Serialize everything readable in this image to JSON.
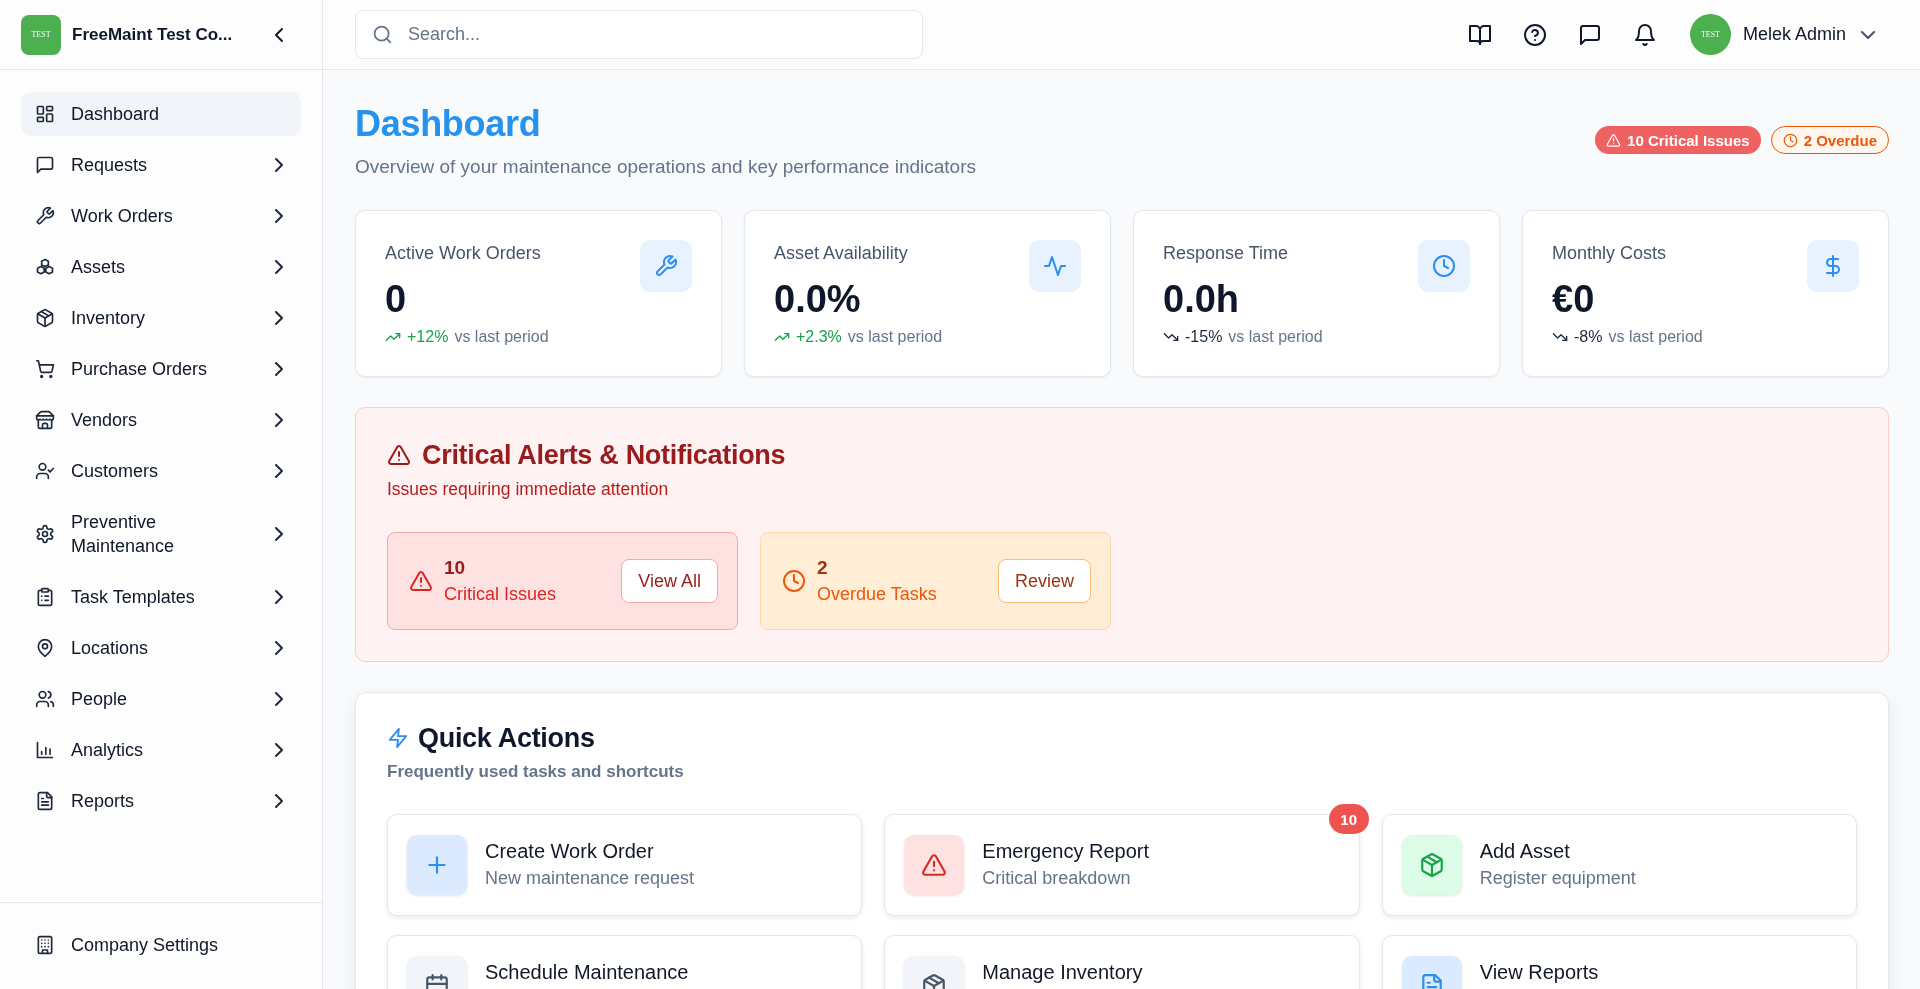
{
  "sidebar": {
    "logo_text": "TEST",
    "brand": "FreeMaint Test Co...",
    "items": [
      {
        "label": "Dashboard",
        "selected": true,
        "expandable": false
      },
      {
        "label": "Requests",
        "selected": false,
        "expandable": true
      },
      {
        "label": "Work Orders",
        "selected": false,
        "expandable": true
      },
      {
        "label": "Assets",
        "selected": false,
        "expandable": true
      },
      {
        "label": "Inventory",
        "selected": false,
        "expandable": true
      },
      {
        "label": "Purchase Orders",
        "selected": false,
        "expandable": true
      },
      {
        "label": "Vendors",
        "selected": false,
        "expandable": true
      },
      {
        "label": "Customers",
        "selected": false,
        "expandable": true
      },
      {
        "label": "Preventive Maintenance",
        "selected": false,
        "expandable": true
      },
      {
        "label": "Task Templates",
        "selected": false,
        "expandable": true
      },
      {
        "label": "Locations",
        "selected": false,
        "expandable": true
      },
      {
        "label": "People",
        "selected": false,
        "expandable": true
      },
      {
        "label": "Analytics",
        "selected": false,
        "expandable": true
      },
      {
        "label": "Reports",
        "selected": false,
        "expandable": true
      }
    ],
    "footer_item": {
      "label": "Company Settings"
    }
  },
  "header": {
    "search": {
      "placeholder": "Search..."
    },
    "user": {
      "avatar_text": "TEST",
      "name": "Melek Admin"
    }
  },
  "page": {
    "title": "Dashboard",
    "subtitle": "Overview of your maintenance operations and key performance indicators",
    "badges": [
      {
        "kind": "critical",
        "label": "10 Critical Issues"
      },
      {
        "kind": "overdue",
        "label": "2 Overdue"
      }
    ]
  },
  "stats": [
    {
      "label": "Active Work Orders",
      "value": "0",
      "change": "+12%",
      "rising": true,
      "comparison": "vs last period"
    },
    {
      "label": "Asset Availability",
      "value": "0.0%",
      "change": "+2.3%",
      "rising": true,
      "comparison": "vs last period"
    },
    {
      "label": "Response Time",
      "value": "0.0h",
      "change": "-15%",
      "rising": false,
      "comparison": "vs last period"
    },
    {
      "label": "Monthly Costs",
      "value": "€0",
      "change": "-8%",
      "rising": false,
      "comparison": "vs last period"
    }
  ],
  "alerts": {
    "title": "Critical Alerts & Notifications",
    "subtitle": "Issues requiring immediate attention",
    "items": [
      {
        "kind": "critical",
        "count": "10",
        "label": "Critical Issues",
        "action": "View All"
      },
      {
        "kind": "overdue",
        "count": "2",
        "label": "Overdue Tasks",
        "action": "Review"
      }
    ]
  },
  "quick_actions": {
    "title": "Quick Actions",
    "subtitle": "Frequently used tasks and shortcuts",
    "items": [
      {
        "title": "Create Work Order",
        "description": "New maintenance request",
        "color": "#dbeafe"
      },
      {
        "title": "Emergency Report",
        "description": "Critical breakdown",
        "color": "#fee2e2",
        "badge": "10"
      },
      {
        "title": "Add Asset",
        "description": "Register equipment",
        "color": "#dcfce7"
      },
      {
        "title": "Schedule Maintenance",
        "color": "#f1f5f9"
      },
      {
        "title": "Manage Inventory",
        "color": "#f1f5f9"
      },
      {
        "title": "View Reports",
        "color": "#dbeafe"
      }
    ]
  }
}
